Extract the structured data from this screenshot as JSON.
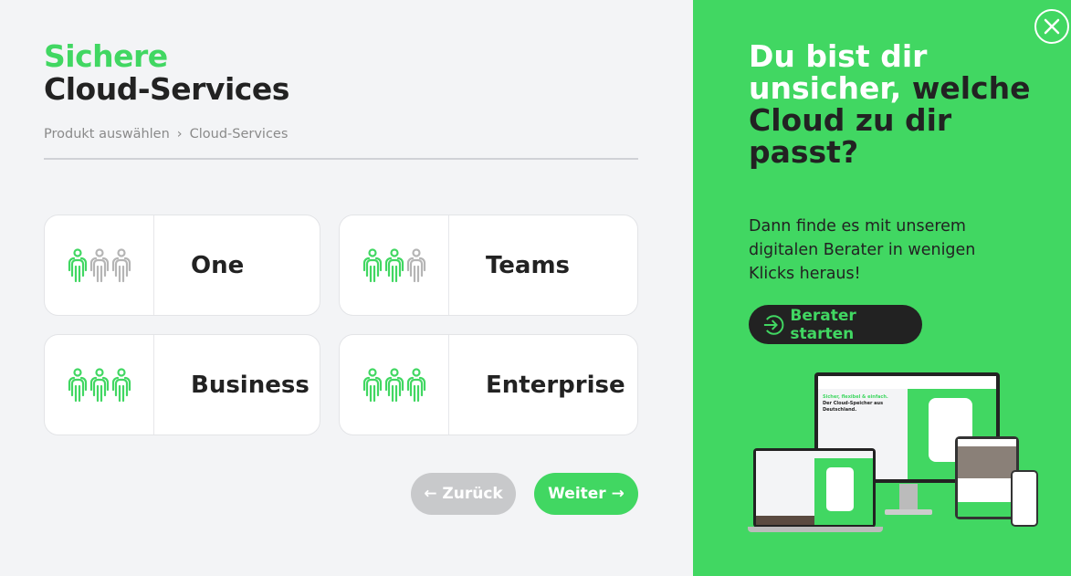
{
  "header": {
    "title_green": "Sichere",
    "title_dark": "Cloud-Services"
  },
  "breadcrumb": {
    "items": [
      "Produkt auswählen",
      "Cloud-Services"
    ],
    "separator": ">"
  },
  "products": [
    {
      "label": "One",
      "active_people": 1
    },
    {
      "label": "Teams",
      "active_people": 2
    },
    {
      "label": "Business",
      "active_people": 3
    },
    {
      "label": "Enterprise",
      "active_people": 3
    }
  ],
  "nav": {
    "back_label": "← Zurück",
    "next_label": "Weiter →"
  },
  "panel": {
    "title_white": "Du bist dir unsicher,",
    "title_dark": "welche Cloud zu dir passt?",
    "text": "Dann finde es mit unserem digitalen Berater in wenigen Klicks heraus!",
    "cta_label": "Berater starten",
    "mockup_headline_green": "Sicher, flexibel & einfach.",
    "mockup_headline": "Der Cloud-Speicher aus Deutschland."
  },
  "colors": {
    "accent": "#41d762",
    "dark": "#222222",
    "inactive_icon": "#b5b5b5",
    "back_button": "#c8c9cb"
  }
}
